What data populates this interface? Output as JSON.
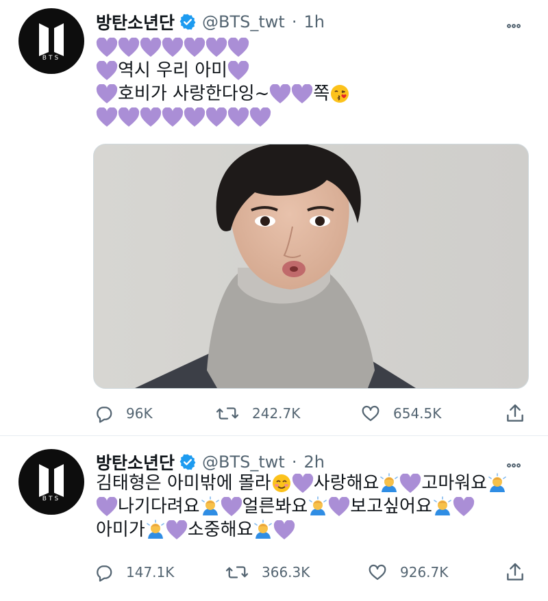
{
  "tweets": [
    {
      "account": {
        "name": "방탄소년단",
        "handle": "@BTS_twt",
        "time": "1h",
        "avatar_text": "BTS"
      },
      "lines": [
        {
          "text_segments": []
        },
        {
          "text_segments": [
            "역시 우리 아미 "
          ]
        },
        {
          "text_segments": [
            "호비가 사랑한다잉~",
            "쪽"
          ]
        },
        {
          "text_segments": []
        }
      ],
      "stats": {
        "replies": "96K",
        "retweets": "242.7K",
        "likes": "654.5K"
      }
    },
    {
      "account": {
        "name": "방탄소년단",
        "handle": "@BTS_twt",
        "time": "2h",
        "avatar_text": "BTS"
      },
      "lines": [
        {
          "text_segments": [
            "김태형은 아미밖에 몰라",
            " 사랑해요",
            " 고마워요"
          ]
        },
        {
          "text_segments": [
            " 나기다려요",
            " 얼른봐요",
            " 보고싶어요"
          ]
        },
        {
          "text_segments": [
            "아미가",
            " 소중해요"
          ]
        }
      ],
      "stats": {
        "replies": "147.1K",
        "retweets": "366.3K",
        "likes": "926.7K"
      }
    }
  ],
  "colors": {
    "heart": "#aa8ed6",
    "verified": "#1d9bf0",
    "muted": "#536471"
  },
  "icons": [
    "bts-logo",
    "verified-badge",
    "more-icon",
    "purple-heart-emoji",
    "kissing-face-emoji",
    "person-bowing-emoji",
    "reply-icon",
    "retweet-icon",
    "like-icon",
    "share-icon"
  ]
}
